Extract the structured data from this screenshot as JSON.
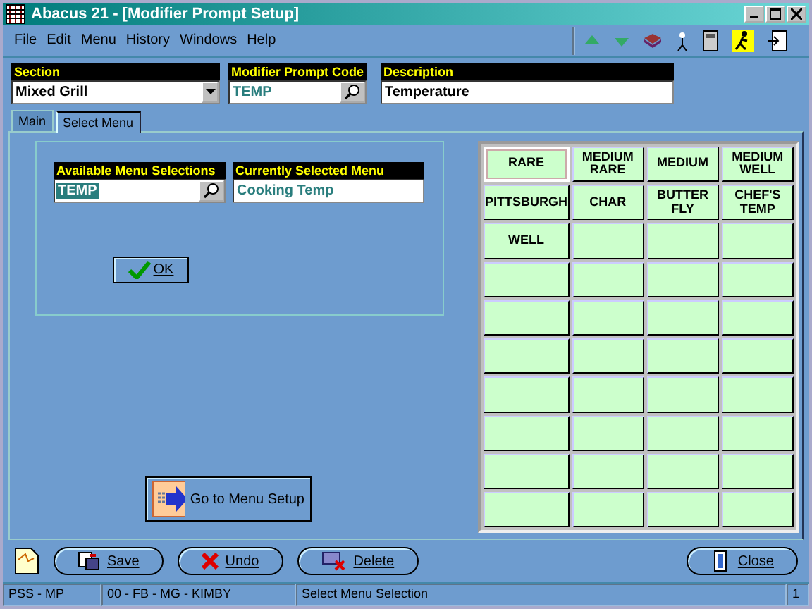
{
  "window": {
    "title": "Abacus 21 - [Modifier Prompt Setup]"
  },
  "menu": [
    "File",
    "Edit",
    "Menu",
    "History",
    "Windows",
    "Help"
  ],
  "fields": [
    {
      "label": "Section",
      "value": "Mixed Grill",
      "kind": "dropdown"
    },
    {
      "label": "Modifier Prompt Code",
      "value": "TEMP",
      "kind": "lookup"
    },
    {
      "label": "Description",
      "value": "Temperature",
      "kind": "text"
    }
  ],
  "tabs": [
    {
      "label": "Main",
      "selected": false
    },
    {
      "label": "Select Menu",
      "selected": true
    }
  ],
  "menu_fields": [
    {
      "label": "Available Menu Selections",
      "value": "TEMP",
      "kind": "lookup"
    },
    {
      "label": "Currently Selected Menu",
      "value": "Cooking Temp",
      "kind": "text"
    }
  ],
  "ok_button": "OK",
  "goto_button": "Go to Menu Setup",
  "grid_buttons": [
    {
      "label": "RARE",
      "selected": true
    },
    {
      "label": "MEDIUM RARE",
      "selected": false
    },
    {
      "label": "MEDIUM",
      "selected": false
    },
    {
      "label": "MEDIUM WELL",
      "selected": false
    },
    {
      "label": "PITTSBURGH",
      "selected": false
    },
    {
      "label": "CHAR",
      "selected": false
    },
    {
      "label": "BUTTER FLY",
      "selected": false
    },
    {
      "label": "CHEF'S TEMP",
      "selected": false
    },
    {
      "label": "WELL",
      "selected": false
    }
  ],
  "actions": [
    {
      "label": "Save",
      "kind": "save"
    },
    {
      "label": "Undo",
      "kind": "undo"
    },
    {
      "label": "Delete",
      "kind": "delete"
    }
  ],
  "close_button": "Close",
  "status_bar": [
    "PSS - MP",
    "00 - FB - MG - KIMBY",
    "Select Menu Selection",
    "1"
  ]
}
